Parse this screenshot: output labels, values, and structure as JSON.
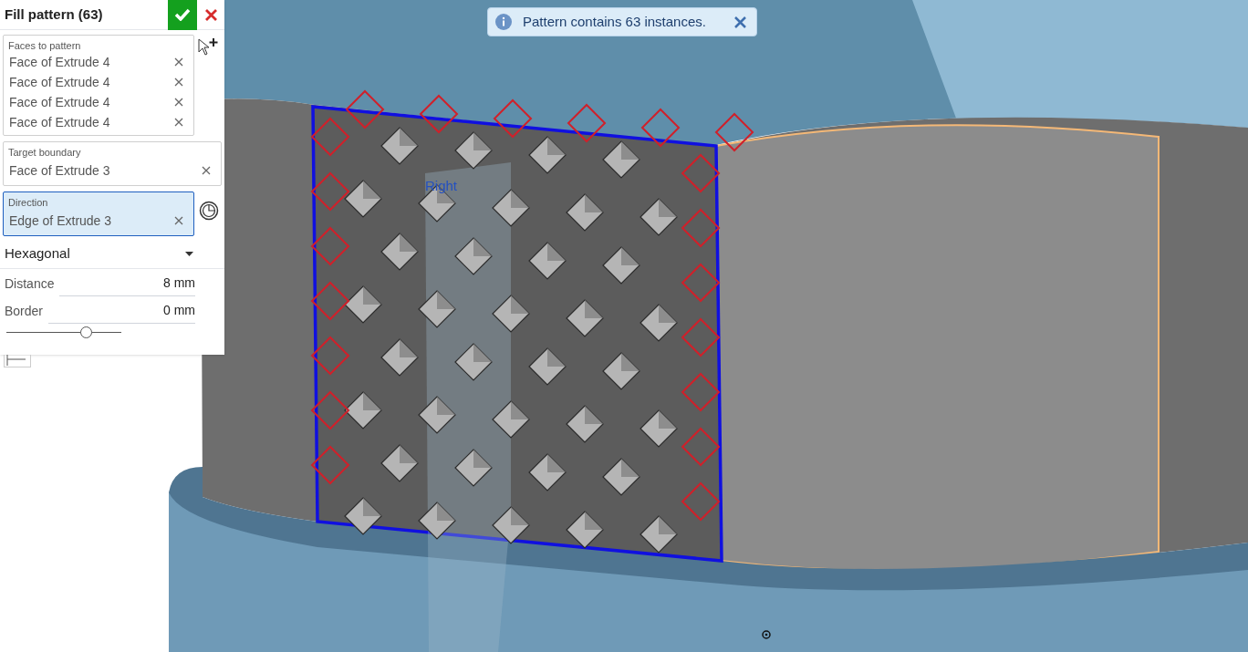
{
  "panel": {
    "title": "Fill pattern (63)",
    "faces_to_pattern": {
      "label": "Faces to pattern",
      "items": [
        "Face of Extrude 4",
        "Face of Extrude 4",
        "Face of Extrude 4",
        "Face of Extrude 4"
      ],
      "selected": false
    },
    "target_boundary": {
      "label": "Target boundary",
      "items": [
        "Face of Extrude 3"
      ],
      "selected": false
    },
    "direction": {
      "label": "Direction",
      "items": [
        "Edge of Extrude 3"
      ],
      "selected": true
    },
    "pattern_type": "Hexagonal",
    "fields": [
      {
        "label": "Distance",
        "value": "8 mm"
      },
      {
        "label": "Border",
        "value": "0 mm"
      }
    ],
    "slider": {
      "level": 0.69
    }
  },
  "notification": {
    "text": "Pattern contains 63 instances."
  },
  "viewport": {
    "plane_label": "Right"
  }
}
